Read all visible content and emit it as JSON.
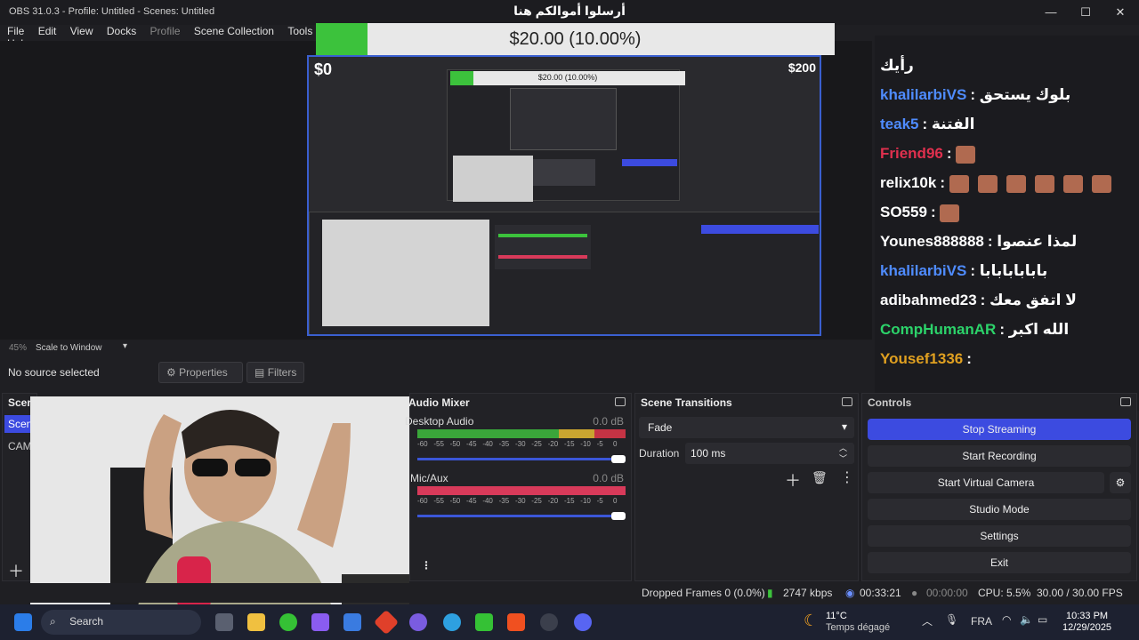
{
  "window": {
    "title": "OBS 31.0.3 - Profile: Untitled - Scenes: Untitled",
    "center_title": "أرسلوا أموالكم هنا",
    "controls": [
      "—",
      "☐",
      "✕"
    ]
  },
  "menu": [
    "File",
    "Edit",
    "View",
    "Docks",
    "Profile",
    "Scene Collection",
    "Tools",
    "Help"
  ],
  "goal": {
    "text": "$20.00 (10.00%)",
    "fraction": 0.1,
    "min_label": "$0",
    "max_label": "$200"
  },
  "nested_goal": {
    "text": "$20.00 (10.00%)",
    "fraction": 0.1
  },
  "chat": [
    {
      "user": "",
      "msg": "رأيك",
      "color": "#ffffff"
    },
    {
      "user": "khalilarbiVS",
      "msg": "بلوك يستحق",
      "color": "#4f8cff"
    },
    {
      "user": "teak5",
      "msg": "الفتنة",
      "color": "#4f8cff"
    },
    {
      "user": "Friend96",
      "msg": "",
      "color": "#e0304e",
      "emotes": 1
    },
    {
      "user": "relix10k",
      "msg": "",
      "color": "#ffffff",
      "emotes": 6
    },
    {
      "user": "SO559",
      "msg": "",
      "color": "#ffffff",
      "emotes": 1
    },
    {
      "user": "Younes888888",
      "msg": "لمذا عنصوا",
      "color": "#ffffff"
    },
    {
      "user": "khalilarbiVS",
      "msg": "بابابابابابا",
      "color": "#4f8cff"
    },
    {
      "user": "adibahmed23",
      "msg": "لا اتفق معك",
      "color": "#ffffff"
    },
    {
      "user": "CompHumanAR",
      "msg": "الله اكبر",
      "color": "#2cd36a"
    },
    {
      "user": "Yousef1336",
      "msg": "",
      "color": "#e0a020"
    }
  ],
  "zoom": {
    "level": "45%",
    "mode": "Scale to Window"
  },
  "source_bar": {
    "no_source": "No source selected",
    "properties": "Properties",
    "filters": "Filters"
  },
  "docks": {
    "scenes": {
      "title": "Scenes",
      "items": [
        "Scene",
        "CAM"
      ]
    },
    "audio": {
      "title": "Audio Mixer",
      "channels": [
        {
          "name": "Desktop Audio",
          "db": "0.0 dB",
          "level": 0.85
        },
        {
          "name": "Mic/Aux",
          "db": "0.0 dB",
          "level": 0.82
        }
      ],
      "scale": [
        "-60",
        "-55",
        "-50",
        "-45",
        "-40",
        "-35",
        "-30",
        "-25",
        "-20",
        "-15",
        "-10",
        "-5",
        "0"
      ]
    },
    "transitions": {
      "title": "Scene Transitions",
      "type": "Fade",
      "duration_label": "Duration",
      "duration": "100 ms"
    },
    "controls": {
      "title": "Controls",
      "buttons": [
        "Stop Streaming",
        "Start Recording",
        "Start Virtual Camera",
        "Studio Mode",
        "Settings",
        "Exit"
      ]
    }
  },
  "status": {
    "dropped": "Dropped Frames 0 (0.0%)",
    "kbps": "2747 kbps",
    "live": "00:33:21",
    "rec": "00:00:00",
    "cpu": "CPU: 5.5%",
    "fps": "30.00 / 30.00 FPS"
  },
  "taskbar": {
    "search": "Search",
    "weather_temp": "11°C",
    "weather_desc": "Temps dégagé",
    "lang": "FRA",
    "time": "10:33 PM",
    "date": "12/29/2025"
  }
}
